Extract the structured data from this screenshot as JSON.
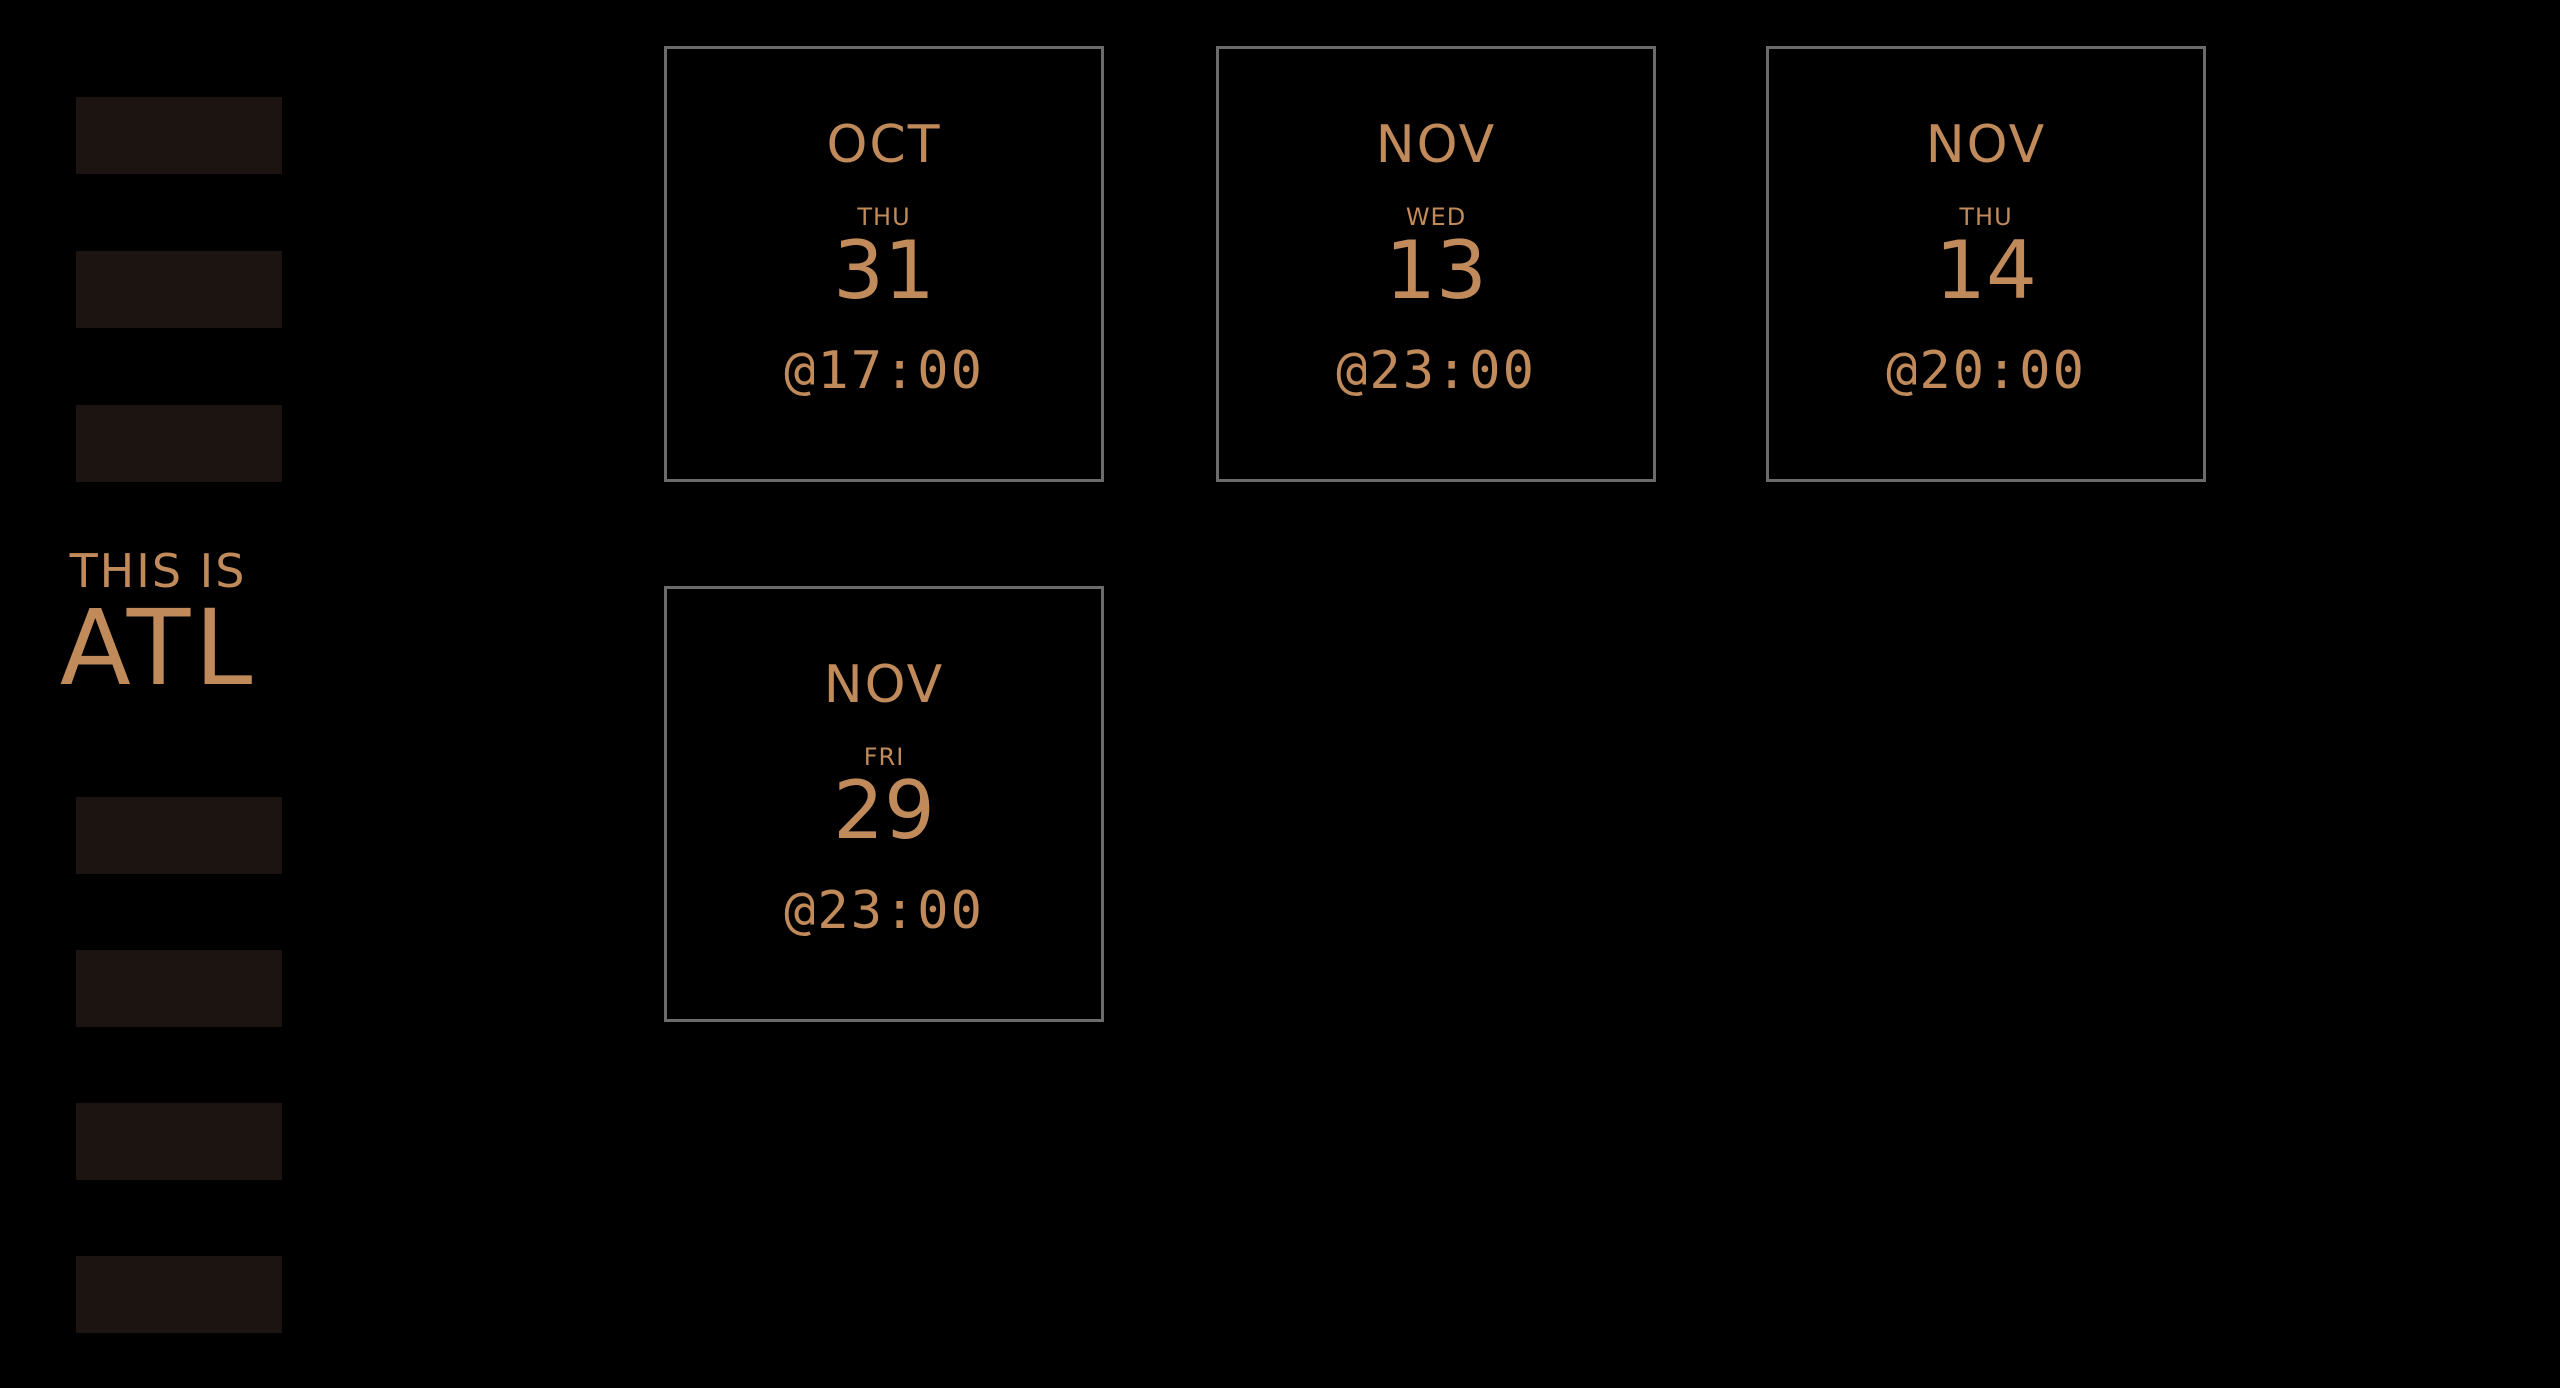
{
  "colors": {
    "background": "#000000",
    "accent": "#c08a5a",
    "sidebar_block": "#1b1410",
    "card_border": "#6b6b6b"
  },
  "logo": {
    "line1": "THIS IS",
    "line2": "ATL"
  },
  "events": [
    {
      "month": "OCT",
      "weekday": "THU",
      "day": "31",
      "time": "@17:00"
    },
    {
      "month": "NOV",
      "weekday": "WED",
      "day": "13",
      "time": "@23:00"
    },
    {
      "month": "NOV",
      "weekday": "THU",
      "day": "14",
      "time": "@20:00"
    },
    {
      "month": "NOV",
      "weekday": "FRI",
      "day": "29",
      "time": "@23:00"
    }
  ]
}
